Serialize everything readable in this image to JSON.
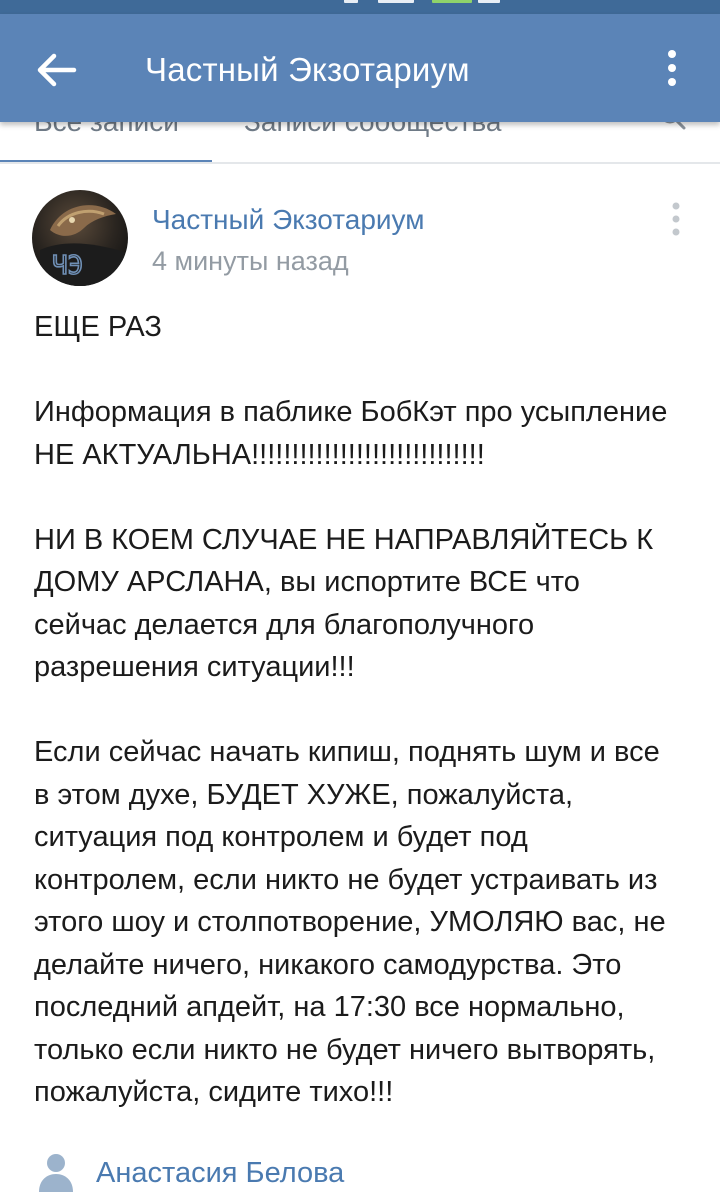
{
  "colors": {
    "header": "#5b84b7",
    "statusbar": "#3f6a98",
    "link": "#4a7ab0",
    "text": "#1b1b1b",
    "muted": "#939ba3"
  },
  "header": {
    "title": "Частный Экзотариум",
    "back_icon": "arrow-left-icon",
    "menu_icon": "more-vertical-icon"
  },
  "tabs": [
    {
      "label": "Все записи",
      "active": true
    },
    {
      "label": "Записи сообщества",
      "active": false
    }
  ],
  "tabs_search_icon": "search-icon",
  "post": {
    "author": "Частный Экзотариум",
    "time": "4 минуты назад",
    "avatar_text": "ЧЭ",
    "paragraphs": [
      "ЕЩЕ РАЗ",
      "Информация в паблике БобКэт про усыпление\nНЕ АКТУАЛЬНА!!!!!!!!!!!!!!!!!!!!!!!!!!!!!",
      "НИ В КОЕМ СЛУЧАЕ НЕ НАПРАВЛЯЙТЕСЬ К\nДОМУ АРСЛАНА, вы испортите ВСЕ что\nсейчас делается для благополучного\nразрешения ситуации!!!",
      "Если сейчас начать кипиш, поднять шум и все\nв этом духе, БУДЕТ ХУЖЕ, пожалуйста,\nситуация под контролем и будет под\nконтролем, если никто не будет устраивать из\nэтого шоу и столпотворение, УМОЛЯЮ вас, не\nделайте ничего, никакого самодурства. Это\nпоследний апдейт, на 17:30 все нормально,\nтолько если никто не будет ничего вытворять,\nпожалуйста, сидите тихо!!!"
    ]
  },
  "comment": {
    "author": "Анастасия Белова",
    "icon": "user-icon"
  }
}
